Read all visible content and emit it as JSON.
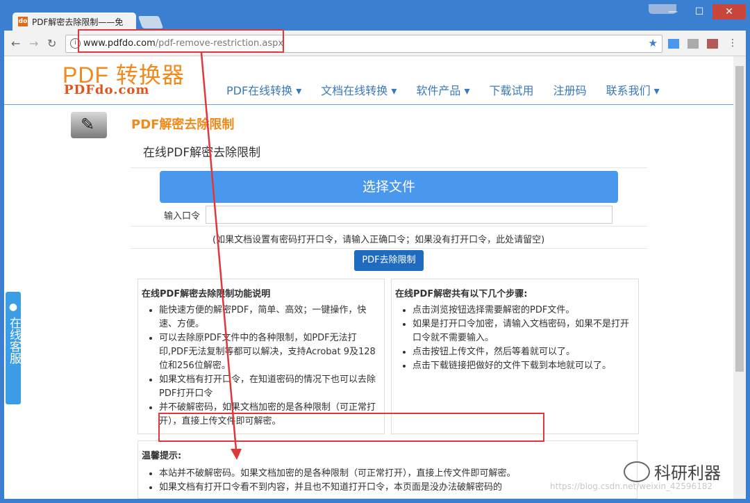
{
  "browser": {
    "tab_title": "PDF解密去除限制——免",
    "favicon_text": "do",
    "url_host": "www.pdfdo.com",
    "url_path": "/pdf-remove-restriction.aspx",
    "window_controls": {
      "minimize": "—",
      "maximize": "☐",
      "close": "✕"
    }
  },
  "site": {
    "logo_main": "PDF 转换器",
    "logo_sub": "PDFdo.com",
    "nav": [
      "PDF在线转换 ▾",
      "文档在线转换 ▾",
      "软件产品 ▾",
      "下载试用",
      "注册码",
      "联系我们 ▾"
    ]
  },
  "tool": {
    "title": "PDF解密去除限制",
    "subtitle": "在线PDF解密去除限制",
    "choose_file": "选择文件",
    "password_label": "输入口令",
    "password_value": "",
    "hint": "(如果文档设置有密码打开口令，请输入正确口令；如果没有打开口令，此处请留空)",
    "submit": "PDF去除限制"
  },
  "features": {
    "heading": "在线PDF解密去除限制功能说明",
    "items": [
      "能快速方便的解密PDF，简单、高效；一键操作，快速、方便。",
      "可以去除原PDF文件中的各种限制，如PDF无法打印,PDF无法复制等都可以解决，支持Acrobat 9及128位和256位解密。",
      "如果文档有打开口令，在知道密码的情况下也可以去除PDF打开口令",
      "并不破解密码，如果文档加密的是各种限制（可正常打开），直接上传文件即可解密。"
    ]
  },
  "steps": {
    "heading": "在线PDF解密共有以下几个步骤:",
    "items": [
      "点击浏览按钮选择需要解密的PDF文件。",
      "如果是打开口令加密，请输入文档密码，如果不是打开口令就不需要输入。",
      "点击按钮上传文件，然后等着就可以了。",
      "点击下载链接把做好的文件下载到本地就可以了。"
    ]
  },
  "tips": {
    "heading": "温馨提示:",
    "items": [
      "本站并不破解密码。如果文档加密的是各种限制（可正常打开），直接上传文件即可解密。",
      "如果文档有打开口令看不到内容，并且也不知道打开口令，本页面是没办法破解密码的"
    ]
  },
  "support_tab": "在线客服",
  "watermark": "https://blog.csdn.net/weixin_42596182",
  "wechat_name": "科研利器",
  "colors": {
    "accent": "#4a97ee",
    "logo": "#f08a1c",
    "highlight": "#e0373a"
  }
}
